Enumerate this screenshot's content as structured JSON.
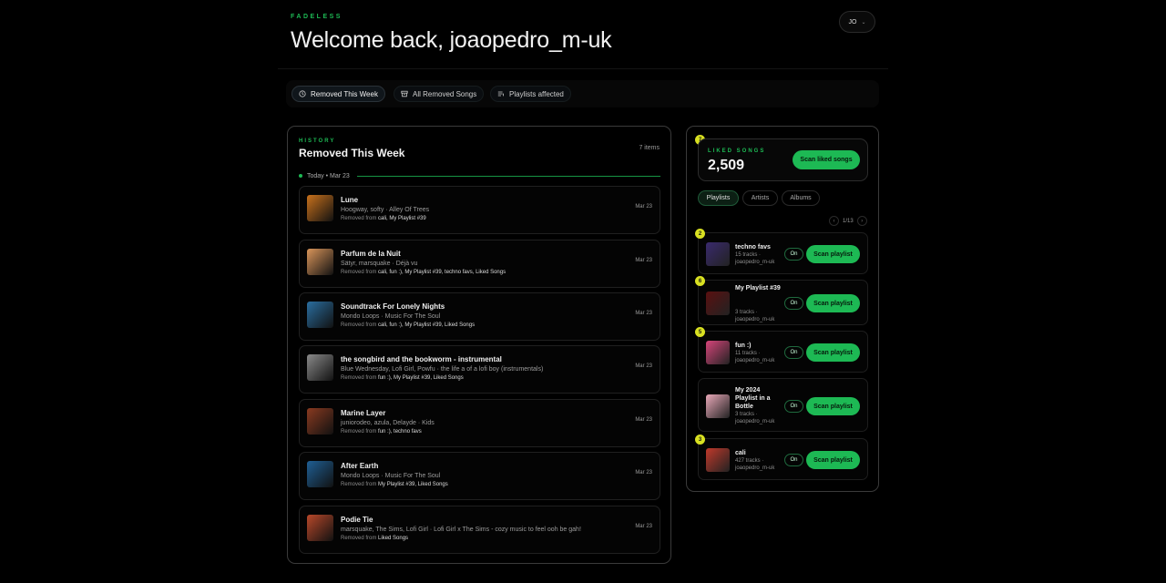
{
  "app": {
    "brand": "FADELESS",
    "welcome": "Welcome back, joaopedro_m-uk",
    "avatar_initials": "JO"
  },
  "tabs": [
    {
      "label": "Removed This Week",
      "icon": "clock-icon",
      "active": true
    },
    {
      "label": "All Removed Songs",
      "icon": "archive-icon",
      "active": false
    },
    {
      "label": "Playlists affected",
      "icon": "playlist-icon",
      "active": false
    }
  ],
  "history": {
    "eyebrow": "HISTORY",
    "title": "Removed This Week",
    "count": "7 items",
    "day_label": "Today • Mar 23",
    "removed_prefix": "Removed from",
    "songs": [
      {
        "title": "Lune",
        "subtitle": "Hoogway, softy · Alley Of Trees",
        "removed_from": "cali, My Playlist #39",
        "date": "Mar 23",
        "art": "#c8711c"
      },
      {
        "title": "Parfum de la Nuit",
        "subtitle": "Sätyr, marsquake · Déjà vu",
        "removed_from": "cali, fun :), My Playlist #39, techno favs, Liked Songs",
        "date": "Mar 23",
        "art": "#d9955a"
      },
      {
        "title": "Soundtrack For Lonely Nights",
        "subtitle": "Mondo Loops · Music For The Soul",
        "removed_from": "cali, fun :), My Playlist #39, Liked Songs",
        "date": "Mar 23",
        "art": "#2a6ea0"
      },
      {
        "title": "the songbird and the bookworm - instrumental",
        "subtitle": "Blue Wednesday, Lofi Girl, Powfu · the life a of a lofi boy (instrumentals)",
        "removed_from": "fun :), My Playlist #39, Liked Songs",
        "date": "Mar 23",
        "art": "#8a8a8a"
      },
      {
        "title": "Marine Layer",
        "subtitle": "juniorodeo, azula, Delayde · Kids",
        "removed_from": "fun :), techno favs",
        "date": "Mar 23",
        "art": "#8a3a20"
      },
      {
        "title": "After Earth",
        "subtitle": "Mondo Loops · Music For The Soul",
        "removed_from": "My Playlist #39, Liked Songs",
        "date": "Mar 23",
        "art": "#1f5f95"
      },
      {
        "title": "Podie Tie",
        "subtitle": "marsquake, The Sims, Lofi Girl · Lofi Girl x The Sims - cozy music to feel ooh be gah!",
        "removed_from": "Liked Songs",
        "date": "Mar 23",
        "art": "#b8482a"
      }
    ]
  },
  "liked": {
    "badge": "7",
    "eyebrow": "LIKED SONGS",
    "count": "2,509",
    "scan_label": "Scan liked songs"
  },
  "filters": [
    {
      "label": "Playlists",
      "active": true
    },
    {
      "label": "Artists",
      "active": false
    },
    {
      "label": "Albums",
      "active": false
    }
  ],
  "pager": {
    "label": "1/13"
  },
  "playlists": [
    {
      "badge": "2",
      "name": "techno favs",
      "tracks": "15 tracks ·",
      "owner": "joaopedro_m-uk",
      "toggle": "On",
      "scan_label": "Scan playlist",
      "thumb": "#3a2a6e"
    },
    {
      "badge": "6",
      "name": "My Playlist #39",
      "tracks": "3 tracks ·",
      "owner": "joaopedro_m-uk",
      "toggle": "On",
      "scan_label": "Scan playlist",
      "thumb": "#5a1010"
    },
    {
      "badge": "5",
      "name": "fun :)",
      "tracks": "11 tracks ·",
      "owner": "joaopedro_m-uk",
      "toggle": "On",
      "scan_label": "Scan playlist",
      "thumb": "#d6457a"
    },
    {
      "badge": "",
      "name": "My 2024 Playlist in a Bottle",
      "tracks": "3 tracks ·",
      "owner": "joaopedro_m-uk",
      "toggle": "On",
      "scan_label": "Scan playlist",
      "thumb": "#e9a8b8"
    },
    {
      "badge": "3",
      "name": "cali",
      "tracks": "427 tracks ·",
      "owner": "joaopedro_m-uk",
      "toggle": "On",
      "scan_label": "Scan playlist",
      "thumb": "#c0392b"
    }
  ]
}
